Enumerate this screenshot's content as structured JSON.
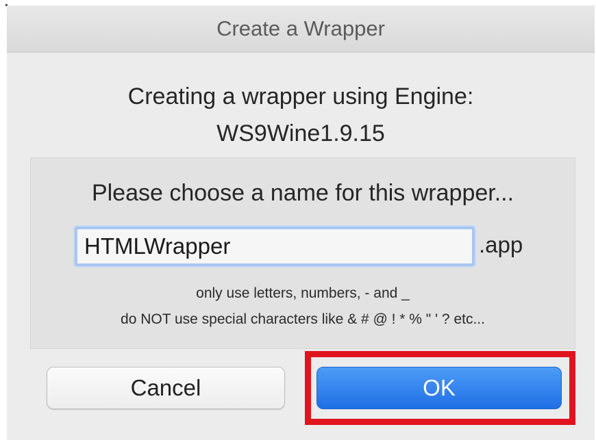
{
  "window": {
    "title": "Create a Wrapper"
  },
  "engine": {
    "line1": "Creating a wrapper using Engine:",
    "line2": "WS9Wine1.9.15"
  },
  "name_group": {
    "prompt": "Please choose a name for this wrapper...",
    "input_value": "HTMLWrapper",
    "suffix": ".app",
    "hint_line1": "only use letters, numbers, - and _",
    "hint_line2": "do NOT use special characters like & # @ ! * % \" ' ? etc..."
  },
  "buttons": {
    "cancel_label": "Cancel",
    "ok_label": "OK"
  },
  "colors": {
    "accent": "#1f6fe6",
    "highlight": "#e0141f"
  }
}
